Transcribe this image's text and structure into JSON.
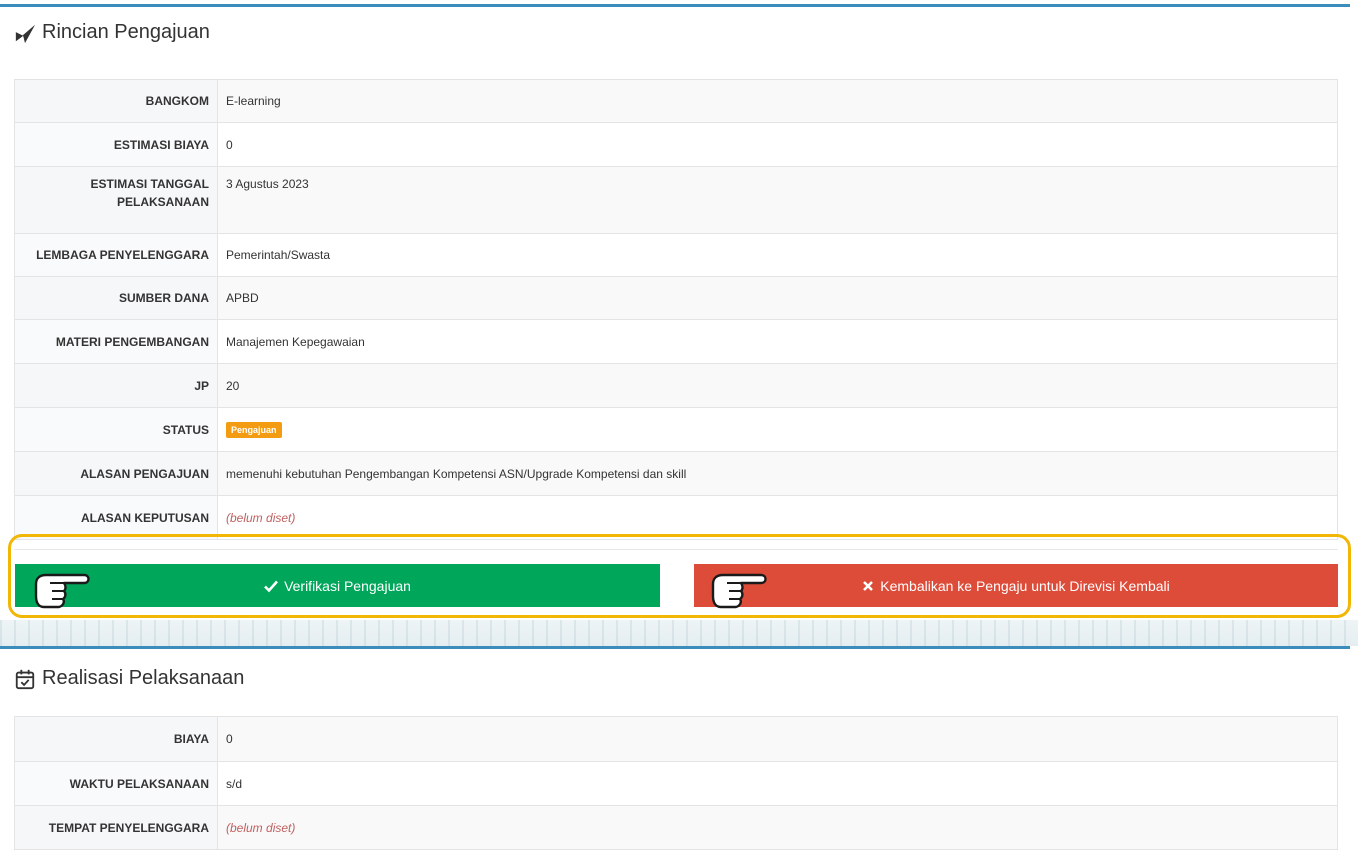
{
  "rincian": {
    "title": "Rincian Pengajuan",
    "rows": [
      {
        "label": "BANGKOM",
        "value": "E-learning"
      },
      {
        "label": "ESTIMASI BIAYA",
        "value": "0"
      },
      {
        "label_line1": "ESTIMASI TANGGAL",
        "label_line2": "PELAKSANAAN",
        "value": "3 Agustus 2023"
      },
      {
        "label": "LEMBAGA PENYELENGGARA",
        "value": "Pemerintah/Swasta"
      },
      {
        "label": "SUMBER DANA",
        "value": "APBD"
      },
      {
        "label": "MATERI PENGEMBANGAN",
        "value": "Manajemen Kepegawaian"
      },
      {
        "label": "JP",
        "value": "20"
      },
      {
        "label": "STATUS",
        "value": "Pengajuan"
      },
      {
        "label": "ALASAN PENGAJUAN",
        "value": "memenuhi kebutuhan Pengembangan Kompetensi ASN/Upgrade Kompetensi dan skill"
      },
      {
        "label": "ALASAN KEPUTUSAN",
        "value": "(belum diset)"
      }
    ]
  },
  "actions": {
    "verify_label": "Verifikasi Pengajuan",
    "reject_label": "Kembalikan ke Pengaju untuk Direvisi Kembali"
  },
  "realisasi": {
    "title": "Realisasi Pelaksanaan",
    "rows": [
      {
        "label": "BIAYA",
        "value": "0"
      },
      {
        "label": "WAKTU PELAKSANAAN",
        "value": "s/d"
      },
      {
        "label": "TEMPAT PENYELENGGARA",
        "value": "(belum diset)"
      }
    ]
  },
  "colors": {
    "accent": "#3c8dbc",
    "verify": "#00a65a",
    "reject": "#dd4b39",
    "badge": "#f39c12",
    "highlight": "#f2b705"
  },
  "icons": {
    "rincian": "paper-plane-icon",
    "realisasi": "calendar-check-icon",
    "verify": "check-icon",
    "reject": "times-icon",
    "pointer": "pointing-hand-icon"
  }
}
